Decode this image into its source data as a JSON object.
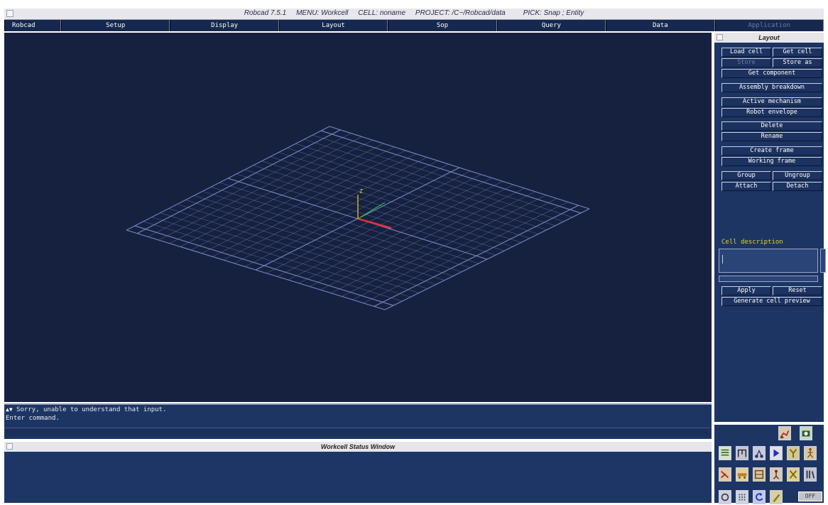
{
  "window": {
    "title": "Robcad 7.5.1     MENU: Workcell     CELL: noname     PROJECT: /C~/Robcad/data         PICK: Snap ; Entity"
  },
  "menu": {
    "items": [
      "Robcad",
      "Setup",
      "Display",
      "Layout",
      "Sop",
      "Query",
      "Data",
      "Application"
    ]
  },
  "command": {
    "lines": [
      "Sorry, unable to understand that input.",
      "Enter command."
    ],
    "input_value": ""
  },
  "status_window": {
    "title": "Workcell Status Window"
  },
  "layout_panel": {
    "title": "Layout",
    "buttons": {
      "load_cell": "Load cell",
      "get_cell": "Get cell",
      "store": "Store",
      "store_as": "Store as",
      "get_component": "Get component",
      "assembly_breakdown": "Assembly breakdown",
      "active_mechanism": "Active mechanism",
      "robot_envelope": "Robot envelope",
      "delete": "Delete",
      "rename": "Rename",
      "create_frame": "Create frame",
      "working_frame": "Working frame",
      "group": "Group",
      "ungroup": "Ungroup",
      "attach": "Attach",
      "detach": "Detach",
      "apply": "Apply",
      "reset": "Reset",
      "generate_cell_preview": "Generate cell preview"
    },
    "cell_description_label": "Cell description",
    "cell_description_value": ""
  },
  "toolbox": {
    "off_label": "OFF"
  },
  "axes": {
    "z_label": "Z"
  },
  "colors": {
    "viewport_bg": "#16213f",
    "panel_bg": "#1d3563",
    "menu_bg": "#16284d",
    "grid_line": "#7a8ccc",
    "axis_x": "#e0303a",
    "axis_y": "#30c040",
    "axis_z": "#f0d020",
    "label_yellow": "#e8d020"
  }
}
